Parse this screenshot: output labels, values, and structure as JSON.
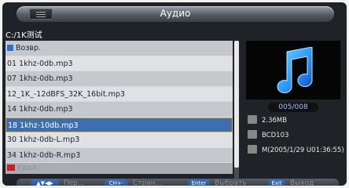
{
  "header": {
    "title": "Аудио"
  },
  "path": "C:/1K测试",
  "files": [
    {
      "label": "Возвр.",
      "kind": "back"
    },
    {
      "label": "01 1khz-0db.mp3"
    },
    {
      "label": "07 1khz-0db.mp3"
    },
    {
      "label": "12_1K_-12dBFS_32K_16bit.mp3"
    },
    {
      "label": "14 1khz-0db.mp3"
    },
    {
      "label": "18 1khz-10db.mp3",
      "selected": true
    },
    {
      "label": "30 1khz-0db-L.mp3"
    },
    {
      "label": "34 1khz-0db-R.mp3"
    }
  ],
  "delete_label": "Удал.",
  "preview": {
    "counter": "005/008",
    "icon": "music-note-icon",
    "accent": "#2ea0ff"
  },
  "details": {
    "size": "2.36MB",
    "artist": "BCD103",
    "modified": "M(2005/1/29 U01:36:55)"
  },
  "footer": {
    "nav_key": "▲▼◀▶",
    "nav_label": "Пер...",
    "page_key": "CH+-",
    "page_label": "Стран...",
    "enter_key": "Enter",
    "enter_label": "Выбрать",
    "exit_key": "Exit",
    "exit_label": "Выход"
  }
}
